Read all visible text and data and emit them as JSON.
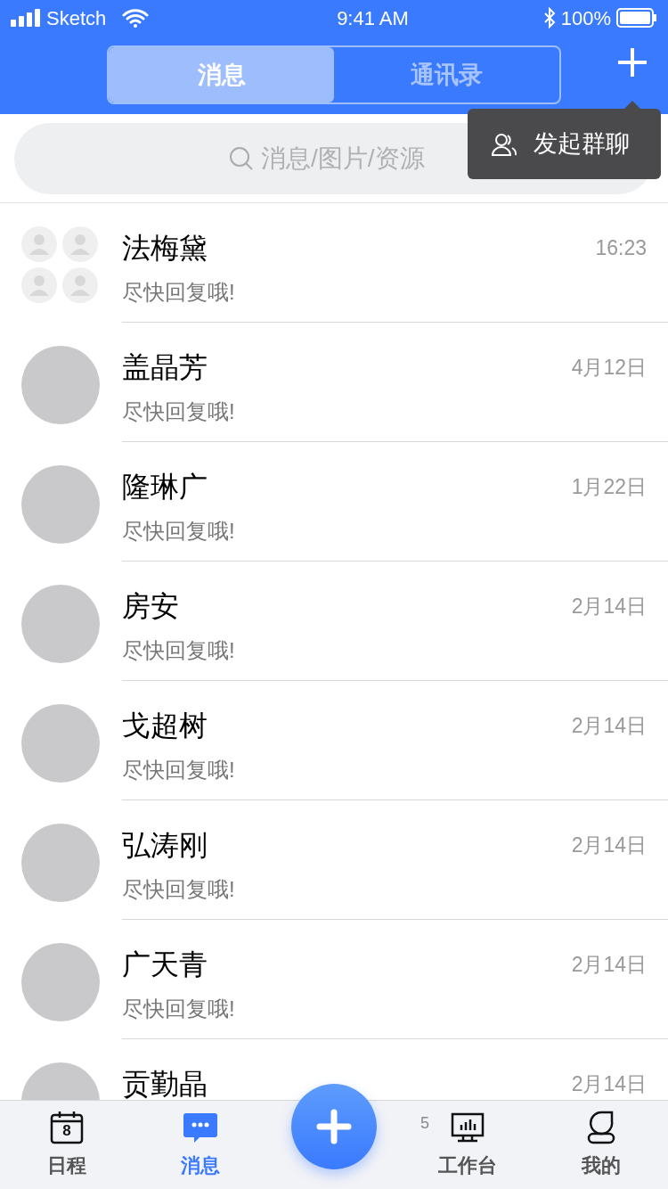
{
  "status_bar": {
    "carrier": "Sketch",
    "time": "9:41 AM",
    "battery": "100%"
  },
  "segments": [
    {
      "label": "消息",
      "selected": true
    },
    {
      "label": "通讯录",
      "selected": false
    }
  ],
  "popup_menu": {
    "items": [
      "发起群聊"
    ]
  },
  "search": {
    "placeholder": "消息/图片/资源"
  },
  "conversations": [
    {
      "kind": "group",
      "name": "法梅黛",
      "message": "尽快回复哦!",
      "time": "16:23"
    },
    {
      "kind": "photo",
      "name": "盖晶芳",
      "message": "尽快回复哦!",
      "time": "4月12日"
    },
    {
      "kind": "photo",
      "name": "隆琳广",
      "message": "尽快回复哦!",
      "time": "1月22日"
    },
    {
      "kind": "photo",
      "name": "房安",
      "message": "尽快回复哦!",
      "time": "2月14日"
    },
    {
      "kind": "photo",
      "name": "戈超树",
      "message": "尽快回复哦!",
      "time": "2月14日"
    },
    {
      "kind": "photo",
      "name": "弘涛刚",
      "message": "尽快回复哦!",
      "time": "2月14日"
    },
    {
      "kind": "photo",
      "name": "广天青",
      "message": "尽快回复哦!",
      "time": "2月14日"
    },
    {
      "kind": "photo",
      "name": "贡勤晶",
      "time": "2月14日"
    }
  ],
  "tab_bar": [
    {
      "label": "日程",
      "kind": "calendar",
      "icon_text": "8",
      "selected": false
    },
    {
      "label": "消息",
      "kind": "chat",
      "selected": true
    },
    {
      "kind": "fab"
    },
    {
      "label": "工作台",
      "kind": "monitor",
      "badge": "5",
      "selected": false
    },
    {
      "label": "我的",
      "kind": "person",
      "selected": false
    }
  ]
}
